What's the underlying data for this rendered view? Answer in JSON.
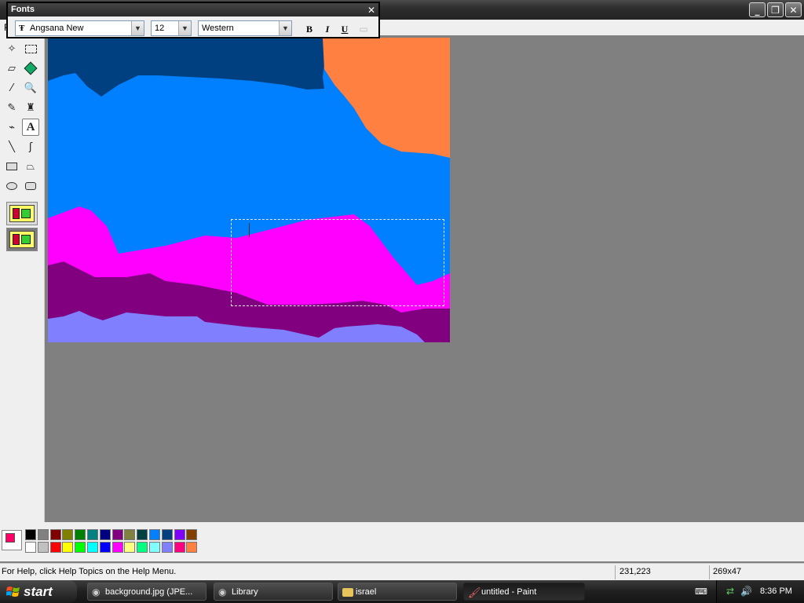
{
  "window": {
    "title": ""
  },
  "menu": {
    "first_item": "F"
  },
  "fonts_toolbar": {
    "title": "Fonts",
    "font_name": "Angsana New",
    "font_size": "12",
    "script": "Western",
    "bold": "B",
    "italic": "I",
    "underline": "U"
  },
  "tools": [
    "free-form-select",
    "rect-select",
    "eraser",
    "fill",
    "color-picker",
    "magnifier",
    "pencil",
    "brush",
    "airbrush",
    "text",
    "line",
    "curve",
    "rectangle",
    "polygon",
    "ellipse",
    "rounded-rectangle"
  ],
  "colors": {
    "foreground": "#ff0066",
    "background": "#ffffff",
    "palette_row1": [
      "#000000",
      "#808080",
      "#800000",
      "#808000",
      "#008000",
      "#008080",
      "#000080",
      "#800080",
      "#808040",
      "#004040",
      "#0080ff",
      "#004080",
      "#8000ff",
      "#804000"
    ],
    "palette_row2": [
      "#ffffff",
      "#c0c0c0",
      "#ff0000",
      "#ffff00",
      "#00ff00",
      "#00ffff",
      "#0000ff",
      "#ff00ff",
      "#ffff80",
      "#00ff80",
      "#80ffff",
      "#8080ff",
      "#ff0080",
      "#ff8040"
    ]
  },
  "status": {
    "help": "For Help, click Help Topics on the Help Menu.",
    "coords": "231,223",
    "size": "269x47"
  },
  "taskbar": {
    "start": "start",
    "tasks": [
      "background.jpg (JPE...",
      "Library",
      "israel",
      "untitled - Paint"
    ],
    "time": "8:36 PM"
  }
}
